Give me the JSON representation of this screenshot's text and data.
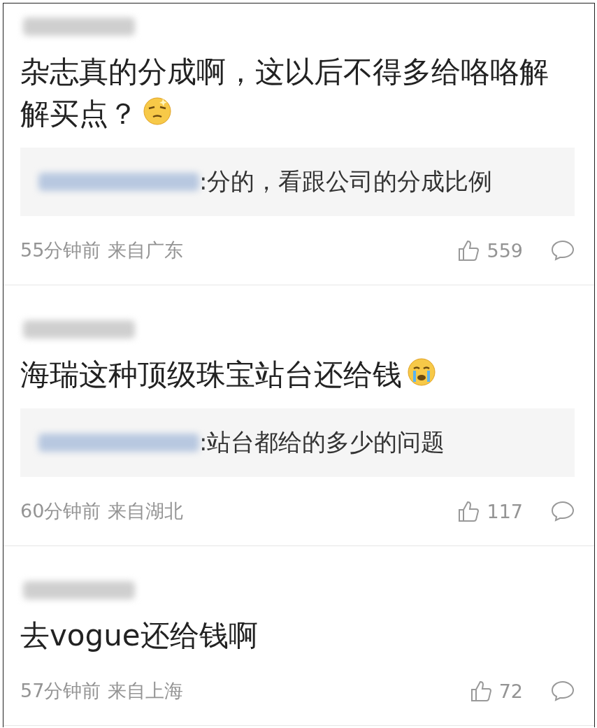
{
  "comments": [
    {
      "text": "杂志真的分成啊，这以后不得多给咯咯解解买点？",
      "emoji": {
        "kind": "smug"
      },
      "reply": {
        "text": ":分的，看跟公司的分成比例"
      },
      "time": "55分钟前",
      "location": "来自广东",
      "likes": "559"
    },
    {
      "text": "海瑞这种顶级珠宝站台还给钱",
      "emoji": {
        "kind": "crying"
      },
      "reply": {
        "text": ":站台都给的多少的问题"
      },
      "time": "60分钟前",
      "location": "来自湖北",
      "likes": "117"
    },
    {
      "text": "去vogue还给钱啊",
      "time": "57分钟前",
      "location": "来自上海",
      "likes": "72"
    }
  ]
}
